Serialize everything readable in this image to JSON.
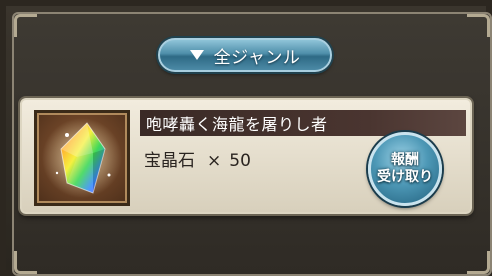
{
  "genre_filter": {
    "label": "全ジャンル",
    "icon": "triangle-down-icon"
  },
  "mission": {
    "title": "咆哮轟く海龍を屠りし者",
    "reward_item": "宝晶石",
    "times_symbol": "×",
    "reward_quantity": "50",
    "item_icon": "rainbow-crystal-icon"
  },
  "receive_button": {
    "line1": "報酬",
    "line2": "受け取り"
  },
  "colors": {
    "button_blue": "#4f8faa",
    "panel_cream": "#f2ecde",
    "title_bar": "#3a2a26"
  }
}
